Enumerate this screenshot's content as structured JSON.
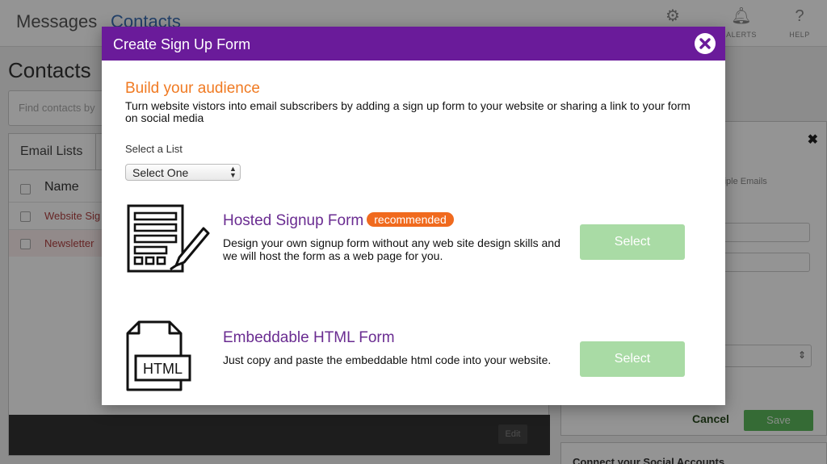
{
  "app": {
    "nav": {
      "messages": "Messages",
      "contacts": "Contacts",
      "alerts_label": "ALERTS",
      "help_label": "HELP",
      "settings_icon": "gear-icon",
      "alerts_icon": "bell-icon",
      "help_icon": "question-icon"
    },
    "page_title": "Contacts",
    "find_placeholder": "Find contacts by",
    "tabs": {
      "email_lists": "Email Lists"
    },
    "table": {
      "column_name": "Name",
      "rows": [
        "Website Sig",
        "Newsletter"
      ]
    },
    "footer": {
      "edit_label": "Edit"
    },
    "side": {
      "hint": "ultiple Emails",
      "select_arrow": "⇕",
      "cancel_label": "Cancel",
      "save_label": "Save"
    },
    "social": {
      "title": "Connect your Social Accounts"
    }
  },
  "modal": {
    "title": "Create Sign Up Form",
    "close_icon": "close-icon",
    "audience": {
      "title": "Build your audience",
      "description": "Turn website vistors into email subscribers by adding a sign up form to your website or sharing a link to your form on social media"
    },
    "list_select": {
      "label": "Select a List",
      "value": "Select One"
    },
    "options": [
      {
        "title": "Hosted Signup Form",
        "badge": "recommended",
        "description": "Design your own signup form without any web site design skills and we will host the form as a web page for you.",
        "button_label": "Select",
        "icon": "form-pen-icon"
      },
      {
        "title": "Embeddable HTML Form",
        "icon_text": "HTML",
        "description": "Just copy and paste the embeddable html code into your website.",
        "button_label": "Select",
        "icon": "html-file-icon"
      }
    ],
    "colors": {
      "header": "#6a1b9a",
      "accent_orange": "#f07a22",
      "option_title": "#6a2c91",
      "select_button": "#a9dba5"
    }
  }
}
